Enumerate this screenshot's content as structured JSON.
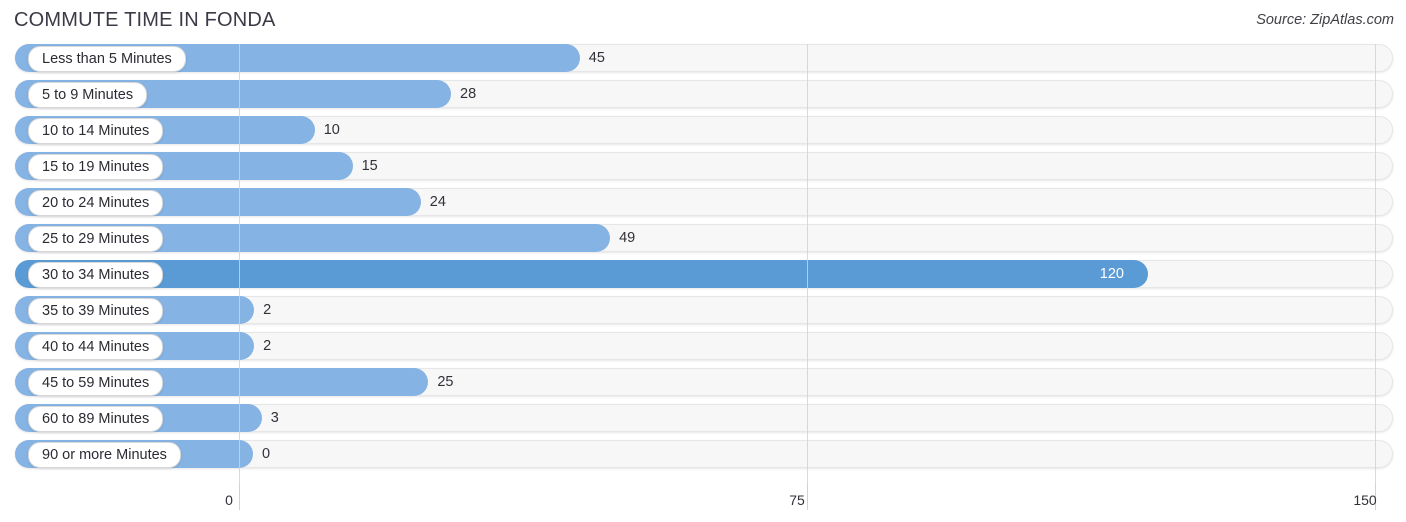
{
  "header": {
    "title": "COMMUTE TIME IN FONDA",
    "source": "Source: ZipAtlas.com"
  },
  "colors": {
    "bar": "#85b3e3",
    "bar_highlight": "#5b9bd5",
    "track": "#f7f7f7",
    "gridline": "#d2d2d2",
    "text": "#31313a",
    "title": "#3b3b47"
  },
  "chart_data": {
    "type": "bar",
    "orientation": "horizontal",
    "title": "COMMUTE TIME IN FONDA",
    "xlabel": "",
    "ylabel": "",
    "xlim": [
      0,
      150
    ],
    "ticks": [
      0,
      75,
      150
    ],
    "tick_labels": [
      "0",
      "75",
      "150"
    ],
    "grid": true,
    "legend": false,
    "categories": [
      "Less than 5 Minutes",
      "5 to 9 Minutes",
      "10 to 14 Minutes",
      "15 to 19 Minutes",
      "20 to 24 Minutes",
      "25 to 29 Minutes",
      "30 to 34 Minutes",
      "35 to 39 Minutes",
      "40 to 44 Minutes",
      "45 to 59 Minutes",
      "60 to 89 Minutes",
      "90 or more Minutes"
    ],
    "values": [
      45,
      28,
      10,
      15,
      24,
      49,
      120,
      2,
      2,
      25,
      3,
      0
    ],
    "value_labels": [
      "45",
      "28",
      "10",
      "15",
      "24",
      "49",
      "120",
      "2",
      "2",
      "25",
      "3",
      "0"
    ],
    "highlight_index": 6
  }
}
